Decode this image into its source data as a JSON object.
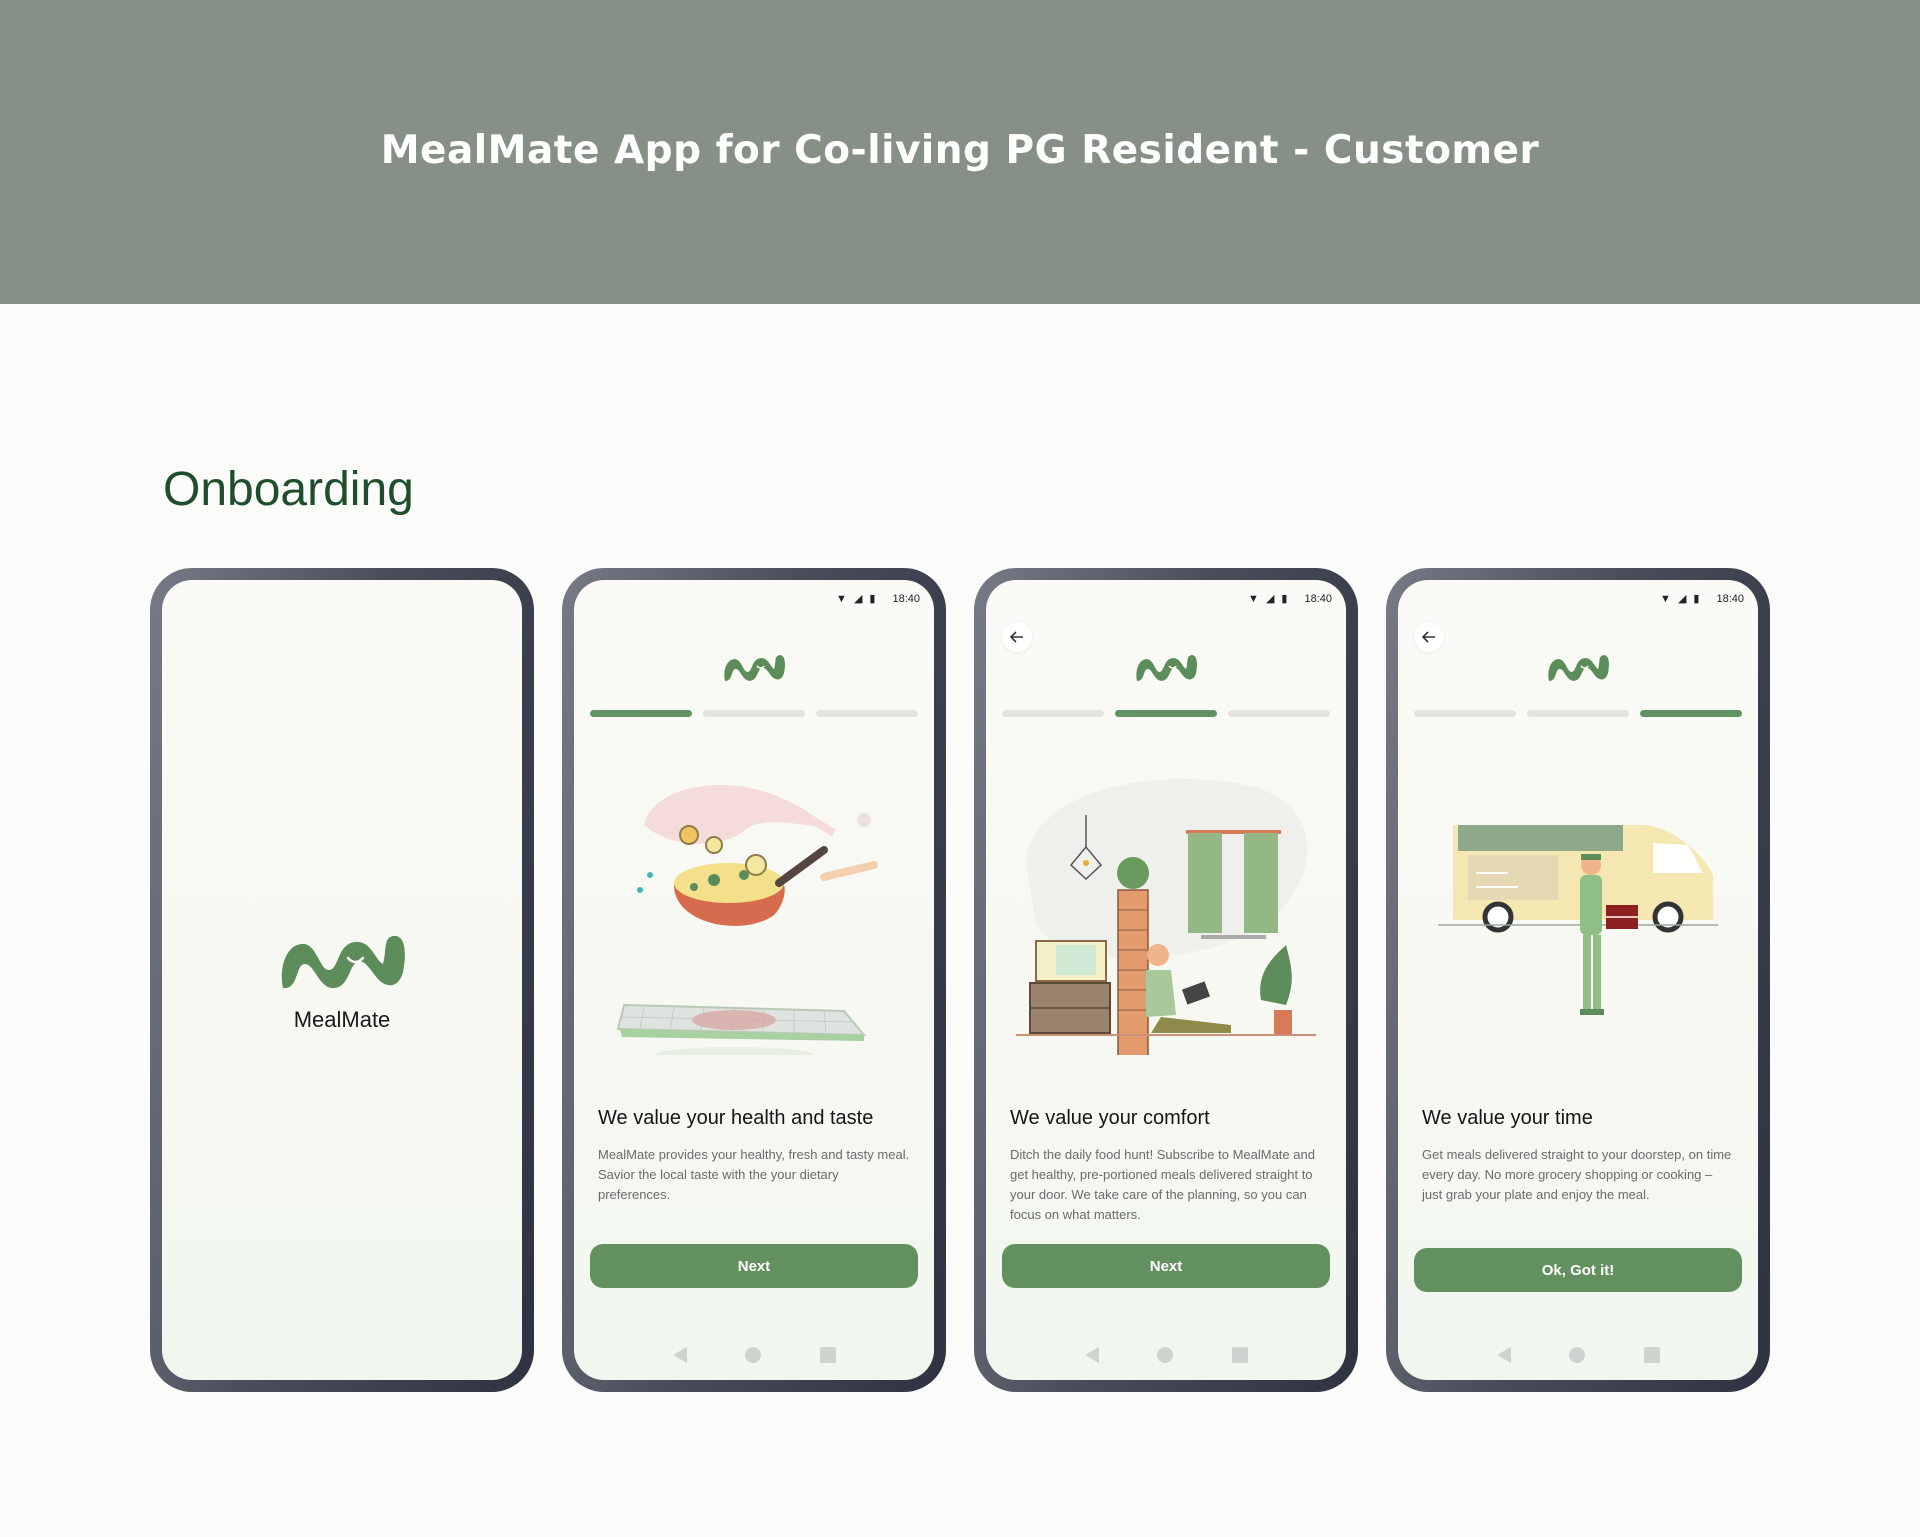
{
  "header": {
    "title": "MealMate App for Co-living PG Resident - Customer"
  },
  "section": {
    "title": "Onboarding"
  },
  "colors": {
    "banner": "#869086",
    "accent": "#62905f",
    "title_green": "#1f4e2d"
  },
  "splash": {
    "app_name": "MealMate"
  },
  "screens": [
    {
      "time": "18:40",
      "step": 1,
      "heading": "We value your health and taste",
      "description": "MealMate provides your healthy, fresh and tasty meal. Savior the local taste with the your dietary preferences.",
      "button": "Next",
      "illustration": "cooking-pan-icon"
    },
    {
      "time": "18:40",
      "step": 2,
      "heading": "We value your comfort",
      "description": "Ditch the daily food hunt! Subscribe to MealMate and get healthy, pre-portioned meals delivered straight to your door. We take care of the planning, so you can focus on what matters.",
      "button": "Next",
      "illustration": "relaxing-room-icon"
    },
    {
      "time": "18:40",
      "step": 3,
      "heading": "We value your time",
      "description": "Get meals delivered straight to your doorstep, on time every day. No more grocery shopping or cooking – just grab your plate and enjoy the meal.",
      "button": "Ok, Got it!",
      "illustration": "delivery-van-icon"
    }
  ]
}
